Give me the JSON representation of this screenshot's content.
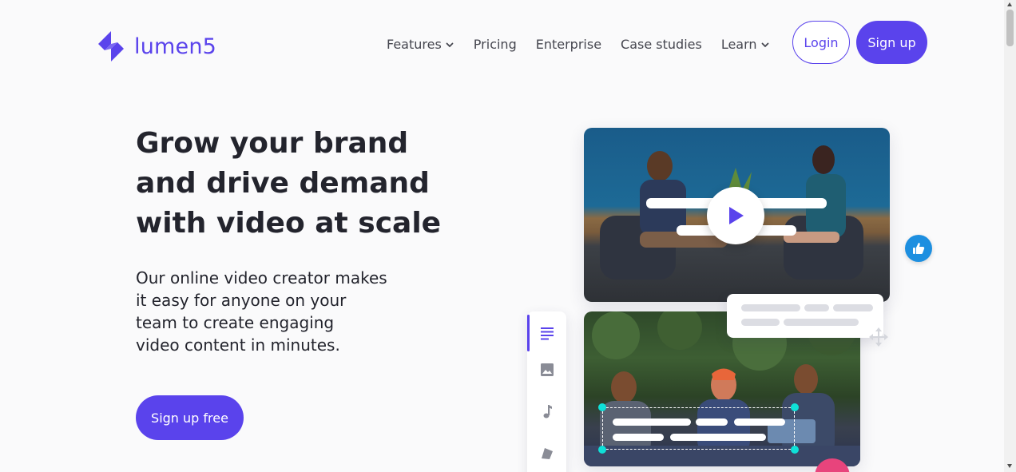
{
  "brand": {
    "name": "lumen5",
    "color": "#5a43ec",
    "logo_icon": "lumen5-logo-icon"
  },
  "nav": {
    "items": [
      {
        "label": "Features",
        "dropdown": true
      },
      {
        "label": "Pricing",
        "dropdown": false
      },
      {
        "label": "Enterprise",
        "dropdown": false
      },
      {
        "label": "Case studies",
        "dropdown": false
      },
      {
        "label": "Learn",
        "dropdown": true
      }
    ],
    "login_label": "Login",
    "signup_label": "Sign up"
  },
  "hero": {
    "title_lines": [
      "Grow your brand",
      "and drive demand",
      "with video at scale"
    ],
    "subtitle_lines": [
      "Our online video creator makes",
      "it easy for anyone on your",
      "team to create engaging",
      "video content in minutes."
    ],
    "cta_label": "Sign up free"
  },
  "illustration": {
    "icons": [
      "play-icon",
      "thumbs-up-icon",
      "move-icon",
      "text-lines-icon",
      "image-icon",
      "music-note-icon",
      "shapes-icon",
      "heart-icon"
    ],
    "accent_teal": "#0fe0d8",
    "like_blue": "#1d8fe0",
    "heart_pink": "#e8447c"
  }
}
